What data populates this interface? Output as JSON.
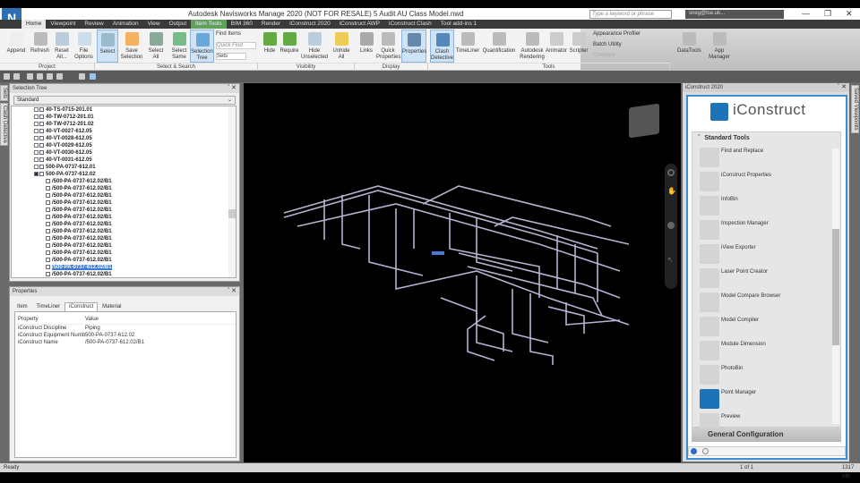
{
  "app": {
    "title": "Autodesk Navisworks Manage 2020 (NOT FOR RESALE)    5 Audit AU Class Model.nwd",
    "logo": "N",
    "search_placeholder": "Type a keyword or phrase",
    "user": "sneg@tse.uk..."
  },
  "tabs": [
    "Home",
    "Viewpoint",
    "Review",
    "Animation",
    "View",
    "Output",
    "Item Tools",
    "BIM 360",
    "Render",
    "iConstruct 2020",
    "iConstruct AWP",
    "iConstruct Clash",
    "Tool add-ins 1"
  ],
  "ribbon": {
    "project": {
      "label": "Project",
      "buttons": [
        "Append",
        "Refresh",
        "Reset All...",
        "File Options"
      ]
    },
    "select_search": {
      "label": "Select & Search",
      "buttons": [
        "Select",
        "Save Selection",
        "Select All",
        "Select Same",
        "Selection Tree"
      ],
      "find_items": "Find Items",
      "quick_find": "Quick Find",
      "sets": "Sets"
    },
    "visibility": {
      "label": "Visibility",
      "buttons": [
        "Hide",
        "Require",
        "Hide Unselected",
        "Unhide All"
      ]
    },
    "display": {
      "label": "Display",
      "buttons": [
        "Links",
        "Quick Properties",
        "Properties"
      ]
    },
    "tools": {
      "label": "Tools",
      "buttons": [
        "Clash Detective",
        "TimeLiner",
        "Quantification",
        "Autodesk Rendering",
        "Animator",
        "Scripter"
      ],
      "small": [
        "Appearance Profiler",
        "Batch Utility",
        "Compare"
      ]
    },
    "extra": [
      "DataTools",
      "App Manager"
    ]
  },
  "side_tabs": {
    "left": [
      "Sets",
      "Clash Detective"
    ],
    "right": [
      "Saved Viewpoints"
    ]
  },
  "selection_tree": {
    "title": "Selection Tree",
    "mode": "Standard",
    "nodes": [
      {
        "label": "40-TS-0715-201.01",
        "level": 0
      },
      {
        "label": "40-TW-0712-201.01",
        "level": 0
      },
      {
        "label": "40-TW-0712-201.02",
        "level": 0
      },
      {
        "label": "40-VT-0027-612.05",
        "level": 0
      },
      {
        "label": "40-VT-0028-612.05",
        "level": 0
      },
      {
        "label": "40-VT-0029-612.05",
        "level": 0
      },
      {
        "label": "40-VT-0030-612.05",
        "level": 0
      },
      {
        "label": "40-VT-0031-612.05",
        "level": 0
      },
      {
        "label": "500-PA-0737-612.01",
        "level": 0
      },
      {
        "label": "500-PA-0737-612.02",
        "level": 0,
        "expanded": true
      },
      {
        "label": "/500-PA-0737-612.02/B1",
        "level": 1
      },
      {
        "label": "/500-PA-0737-612.02/B1",
        "level": 1
      },
      {
        "label": "/500-PA-0737-612.02/B1",
        "level": 1
      },
      {
        "label": "/500-PA-0737-612.02/B1",
        "level": 1
      },
      {
        "label": "/500-PA-0737-612.02/B1",
        "level": 1
      },
      {
        "label": "/500-PA-0737-612.02/B1",
        "level": 1
      },
      {
        "label": "/500-PA-0737-612.02/B1",
        "level": 1
      },
      {
        "label": "/500-PA-0737-612.02/B1",
        "level": 1
      },
      {
        "label": "/500-PA-0737-612.02/B1",
        "level": 1
      },
      {
        "label": "/500-PA-0737-612.02/B1",
        "level": 1
      },
      {
        "label": "/500-PA-0737-612.02/B1",
        "level": 1
      },
      {
        "label": "/500-PA-0737-612.02/B1",
        "level": 1
      },
      {
        "label": "/500-PA-0737-612.02/B1",
        "level": 1,
        "selected": true
      },
      {
        "label": "/500-PA-0737-612.02/B1",
        "level": 1
      }
    ]
  },
  "properties": {
    "title": "Properties",
    "tabs": [
      "Item",
      "TimeLiner",
      "iConstruct",
      "Material"
    ],
    "active_tab": "iConstruct",
    "headers": [
      "Property",
      "Value"
    ],
    "rows": [
      [
        "iConstruct Discipline",
        "Piping"
      ],
      [
        "iConstruct Equipment Number",
        "500-PA-0737-612.02"
      ],
      [
        "iConstruct Name",
        "/500-PA-0737-612.02/B1"
      ]
    ]
  },
  "iconstruct": {
    "title": "iConstruct 2020",
    "brand": "iConstruct",
    "section": "Standard Tools",
    "tools": [
      "Find and Replace",
      "iConstruct Properties",
      "InfoBin",
      "Inspection Manager",
      "iView Exporter",
      "Laser Point Creator",
      "Model Compare Browser",
      "Model Compiler",
      "Module Dimension",
      "PhotoBin",
      "Point Manager",
      "Preview"
    ],
    "general": "General Configuration",
    "accent": "#1d73b8"
  },
  "status": {
    "text": "Ready",
    "page": "1 of 1",
    "memory": "1317 MB"
  }
}
